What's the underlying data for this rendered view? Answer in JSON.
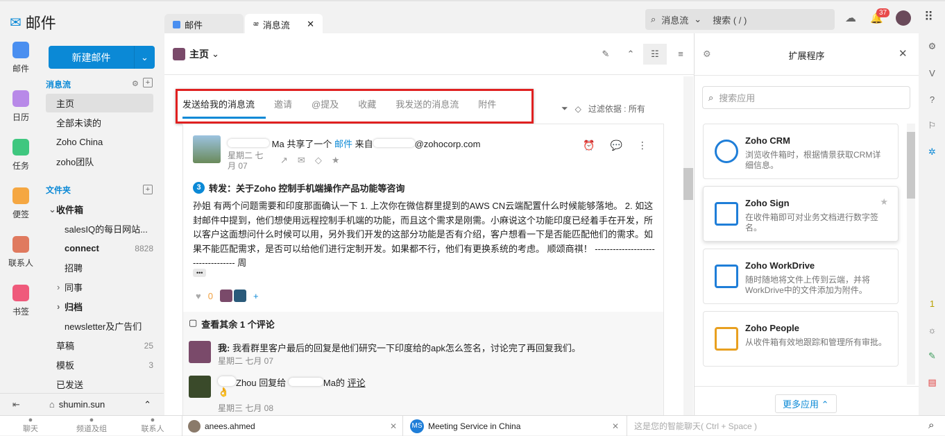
{
  "app": {
    "title": "邮件"
  },
  "tabs": [
    {
      "label": "邮件"
    },
    {
      "label": "消息流"
    }
  ],
  "search": {
    "scope": "消息流",
    "placeholder": "搜索 ( / )"
  },
  "notifications": {
    "count": "37"
  },
  "rail": [
    {
      "label": "邮件",
      "color": "#4a8ff0"
    },
    {
      "label": "日历",
      "color": "#b889e8"
    },
    {
      "label": "任务",
      "color": "#3fc77f"
    },
    {
      "label": "便签",
      "color": "#f5a742"
    },
    {
      "label": "联系人",
      "color": "#e07a5f"
    },
    {
      "label": "书签",
      "color": "#ef5a7b"
    }
  ],
  "compose": {
    "label": "新建邮件"
  },
  "streams": {
    "title": "消息流",
    "items": [
      "主页",
      "全部未读的",
      "Zoho China",
      "zoho团队"
    ]
  },
  "folders": {
    "title": "文件夹",
    "items": [
      {
        "label": "收件箱",
        "count": ""
      },
      {
        "label": "salesIQ的每日网站...",
        "count": ""
      },
      {
        "label": "connect",
        "count": "8828"
      },
      {
        "label": "招聘",
        "count": ""
      },
      {
        "label": "同事",
        "count": ""
      },
      {
        "label": "归档",
        "count": ""
      },
      {
        "label": "newsletter及广告们",
        "count": ""
      },
      {
        "label": "草稿",
        "count": "25"
      },
      {
        "label": "模板",
        "count": "3"
      },
      {
        "label": "已发送",
        "count": ""
      }
    ]
  },
  "account": {
    "name": "shumin.sun"
  },
  "main": {
    "title": "主页",
    "filter_tabs": [
      "发送给我的消息流",
      "邀请",
      "@提及",
      "收藏",
      "我发送的消息流",
      "附件"
    ],
    "filter_label": "过滤依据 : 所有"
  },
  "post": {
    "header_name": "Ma",
    "header_action": "共享了一个",
    "header_link": "邮件",
    "header_from": "来自",
    "header_email": "@zohocorp.com",
    "date": "星期二 七月 07",
    "thread_count": "3",
    "subject": "转发：关于Zoho 控制手机端操作产品功能等咨询",
    "body": "孙姐        有两个问题需要和印度那面确认一下 1. 上次你在微信群里提到的AWS CN云端配置什么时候能够落地。 2. 如这封邮件中提到，他们想使用远程控制手机端的功能，而且这个需求是刚需。小麻说这个功能印度已经着手在开发，所以客户这面想问什么时候可以用，另外我们开发的这部分功能是否有介绍，客户想看一下是否能匹配他们的需求。如果不能匹配需求，是否可以给他们进行定制开发。如果都不行，他们有更换系统的考虑。 顺颂商祺！ ---------------------------------- 周",
    "more": "•••",
    "like_count": "0"
  },
  "comments": {
    "header": "查看其余 1 个评论",
    "items": [
      {
        "author": "我:",
        "text": "我看群里客户最后的回复是他们研究一下印度给的apk怎么签名，讨论完了再回复我们。",
        "date": "星期二 七月 07"
      },
      {
        "author": "Zhou",
        "text": "回复给",
        "target": "Ma的",
        "link": "评论",
        "emoji": "👌",
        "date": "星期三 七月 08"
      }
    ]
  },
  "extensions": {
    "title": "扩展程序",
    "search_placeholder": "搜索应用",
    "apps": [
      {
        "name": "Zoho CRM",
        "desc": "浏览收件箱时，根据情景获取CRM详细信息。"
      },
      {
        "name": "Zoho Sign",
        "desc": "在收件箱即可对业务文档进行数字签名。"
      },
      {
        "name": "Zoho WorkDrive",
        "desc": "随时随地将文件上传到云端，并将WorkDrive中的文件添加为附件。"
      },
      {
        "name": "Zoho People",
        "desc": "从收件箱有效地跟踪和管理所有审批。"
      }
    ],
    "more": "更多应用"
  },
  "bottom": {
    "nav": [
      "聊天",
      "频道及组",
      "联系人"
    ],
    "chats": [
      {
        "name": "anees.ahmed"
      },
      {
        "name": "Meeting Service in China",
        "initials": "MS"
      }
    ],
    "placeholder": "这是您的智能聊天( Ctrl + Space )"
  },
  "colors": {
    "accent": "#0b89d6",
    "highlight": "#e02020"
  }
}
